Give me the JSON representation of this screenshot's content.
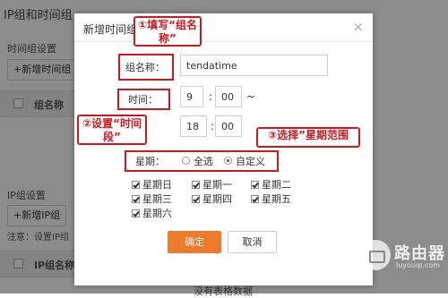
{
  "background": {
    "section_title": "IP组和时间组",
    "time_group_settings": "时间组设置",
    "add_time_group": "+新增时间组",
    "col_group_name": "组名称",
    "ip_group_settings": "IP组设置",
    "add_ip_group": "+新增IP组",
    "note": "注意：设置IP组",
    "col_ip_group_name": "IP组名称",
    "no_data": "没有表格数据"
  },
  "modal": {
    "title": "新增时间组",
    "close": "×",
    "group_name_label": "组名称：",
    "group_name_value": "tendatime",
    "time_label": "时间：",
    "start_hour": "9",
    "start_min": "00",
    "range_sep": "~",
    "end_hour": "18",
    "end_min": "00",
    "week_label": "星期：",
    "week_options": [
      "全选",
      "自定义"
    ],
    "week_selected": "自定义",
    "days": [
      "星期日",
      "星期一",
      "星期二",
      "星期三",
      "星期四",
      "星期五",
      "星期六"
    ],
    "confirm": "确定",
    "cancel": "取消"
  },
  "annotations": {
    "step1": "①填写“组名称”",
    "step2": "②设置“时间段”",
    "step3": "③选择”星期范围"
  },
  "watermark": {
    "name": "路由器",
    "url": "luyouqi.com"
  },
  "colors": {
    "accent_orange": "#ee7a2b",
    "annotation_red": "#d0181e",
    "overlay": "rgba(0,0,0,0.45)"
  }
}
